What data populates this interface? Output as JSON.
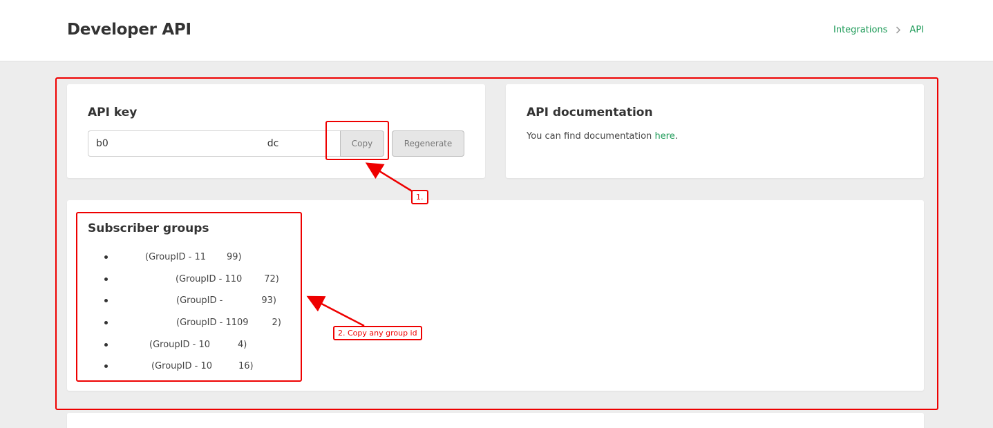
{
  "header": {
    "title": "Developer API",
    "breadcrumb": {
      "integrations": "Integrations",
      "separator_icon": "chevron-right-icon",
      "current": "API"
    }
  },
  "api_key_card": {
    "title": "API key",
    "key_visible_start": "b0",
    "key_visible_end": "dc",
    "copy_label": "Copy",
    "regenerate_label": "Regenerate"
  },
  "api_doc_card": {
    "title": "API documentation",
    "text_before": "You can find documentation ",
    "link_label": "here",
    "text_after": "."
  },
  "groups_card": {
    "title": "Subscriber groups",
    "items": [
      {
        "label": "(GroupID - 11",
        "suffix": "99)"
      },
      {
        "label": "(GroupID - 110",
        "suffix": "72)"
      },
      {
        "label": "(GroupID - ",
        "suffix": "93)"
      },
      {
        "label": "(GroupID - 1109",
        "suffix": "2)"
      },
      {
        "label": "(GroupID - 10",
        "suffix": "4)"
      },
      {
        "label": "(GroupID - 10",
        "suffix": "16)"
      }
    ]
  },
  "annotations": {
    "step1": "1.",
    "step2": "2. Copy any group id",
    "color": "#e00000"
  },
  "colors": {
    "accent_link": "#1c9a57",
    "background": "#ededed",
    "card": "#ffffff"
  }
}
